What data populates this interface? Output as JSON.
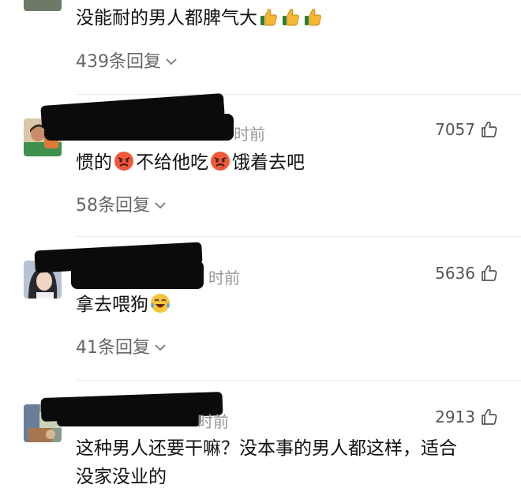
{
  "comments": [
    {
      "text": "没能耐的男人都脾气大",
      "text_emoji_suffix": [
        "thumbs-up-icon",
        "thumbs-up-icon",
        "thumbs-up-icon"
      ],
      "reply_label": "439条回复"
    },
    {
      "time_suffix": "时前",
      "likes": "7057",
      "text_parts": [
        "惯的",
        "不给他吃",
        "饿着去吧"
      ],
      "emojis": [
        "angry-face-icon",
        "angry-face-icon"
      ],
      "reply_label": "58条回复"
    },
    {
      "time_suffix": "时前",
      "likes": "5636",
      "text": "拿去喂狗",
      "emoji": "laughing-crying-face-icon",
      "reply_label": "41条回复"
    },
    {
      "time_suffix": "时前",
      "likes": "2913",
      "text_line1": "这种男人还要干嘛？没本事的男人都这样，适合",
      "text_line2": "没家没业的"
    }
  ],
  "colors": {
    "meta_gray": "#9a9a9a",
    "divider": "#ececec",
    "redaction": "#0b0b0b"
  }
}
